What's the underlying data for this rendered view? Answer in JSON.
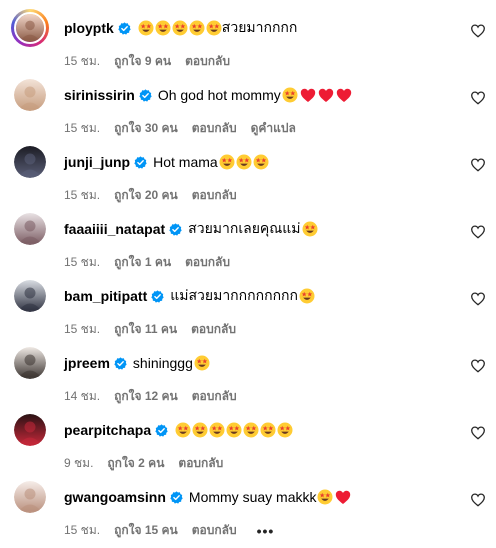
{
  "comments": [
    {
      "username": "ployptk",
      "text": "สวยมากกกก",
      "emoji_before": 5,
      "emoji_after": 0,
      "hearts": 0,
      "time": "15 ชม.",
      "likes": "ถูกใจ 9 คน",
      "reply": "ตอบกลับ",
      "translate": "",
      "more": "",
      "story_ring": true,
      "avatar_colors": [
        "#f2d6c9",
        "#8a5a45"
      ]
    },
    {
      "username": "sirinissirin",
      "text": "Oh god hot mommy",
      "emoji_before": 0,
      "emoji_after": 1,
      "hearts": 3,
      "time": "15 ชม.",
      "likes": "ถูกใจ 30 คน",
      "reply": "ตอบกลับ",
      "translate": "ดูคำแปล",
      "more": "",
      "story_ring": false,
      "avatar_colors": [
        "#f3e3d8",
        "#c69c7d"
      ]
    },
    {
      "username": "junji_junp",
      "text": "Hot mama",
      "emoji_before": 0,
      "emoji_after": 3,
      "hearts": 0,
      "time": "15 ชม.",
      "likes": "ถูกใจ 20 คน",
      "reply": "ตอบกลับ",
      "translate": "",
      "more": "",
      "story_ring": false,
      "avatar_colors": [
        "#1c1c24",
        "#5a5f78"
      ]
    },
    {
      "username": "faaaiiii_natapat",
      "text": "สวยมากเลยคุณแม่",
      "emoji_before": 0,
      "emoji_after": 1,
      "hearts": 0,
      "time": "15 ชม.",
      "likes": "ถูกใจ 1 คน",
      "reply": "ตอบกลับ",
      "translate": "",
      "more": "",
      "story_ring": false,
      "avatar_colors": [
        "#e9e2e4",
        "#7a5b62"
      ]
    },
    {
      "username": "bam_pitipatt",
      "text": "แม่สวยมากกกกกกกก",
      "emoji_before": 0,
      "emoji_after": 1,
      "hearts": 0,
      "time": "15 ชม.",
      "likes": "ถูกใจ 11 คน",
      "reply": "ตอบกลับ",
      "translate": "",
      "more": "",
      "story_ring": false,
      "avatar_colors": [
        "#d9dde3",
        "#2e3140"
      ]
    },
    {
      "username": "jpreem",
      "text": "shininggg",
      "emoji_before": 0,
      "emoji_after": 1,
      "hearts": 0,
      "time": "14 ชม.",
      "likes": "ถูกใจ 12 คน",
      "reply": "ตอบกลับ",
      "translate": "",
      "more": "",
      "story_ring": false,
      "avatar_colors": [
        "#efe9e4",
        "#3a3330"
      ]
    },
    {
      "username": "pearpitchapa",
      "text": "",
      "emoji_before": 0,
      "emoji_after": 7,
      "hearts": 0,
      "time": "9 ชม.",
      "likes": "ถูกใจ 2 คน",
      "reply": "ตอบกลับ",
      "translate": "",
      "more": "",
      "story_ring": false,
      "avatar_colors": [
        "#2a1214",
        "#c7283a"
      ]
    },
    {
      "username": "gwangoamsinn",
      "text": "Mommy suay makkk",
      "emoji_before": 0,
      "emoji_after": 1,
      "hearts": 1,
      "time": "15 ชม.",
      "likes": "ถูกใจ 15 คน",
      "reply": "ตอบกลับ",
      "translate": "",
      "more": "•••",
      "story_ring": false,
      "avatar_colors": [
        "#f6ede9",
        "#b98f7c"
      ]
    }
  ],
  "icons": {
    "verified": "verified-badge-icon",
    "like": "heart-outline-icon",
    "emoji": "star-struck-emoji-icon",
    "heart": "red-heart-emoji-icon"
  },
  "colors": {
    "verified": "#0095f6",
    "heart": "#ed1c34",
    "emoji_face": "#ffcc33",
    "emoji_star": "#e8402d",
    "meta_text": "#737373"
  }
}
